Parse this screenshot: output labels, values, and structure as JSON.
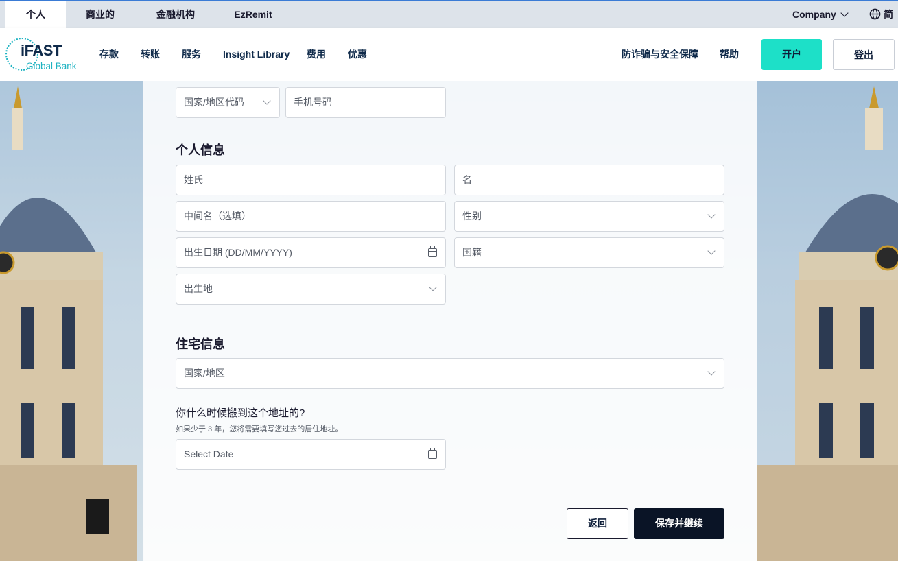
{
  "topbar": {
    "segments": [
      "个人",
      "商业的",
      "金融机构",
      "EzRemit"
    ],
    "company": "Company",
    "language": "简"
  },
  "header": {
    "logo": {
      "line1": "iFAST",
      "line2": "Global Bank"
    },
    "nav": [
      "存款",
      "转账",
      "服务",
      "Insight Library",
      "费用",
      "优惠"
    ],
    "right_links": [
      "防诈骗与安全保障",
      "帮助"
    ],
    "open_account": "开户",
    "login": "登出"
  },
  "form": {
    "phone": {
      "country_code_placeholder": "国家/地区代码",
      "phone_placeholder": "手机号码"
    },
    "personal": {
      "title": "个人信息",
      "surname": "姓氏",
      "given_name": "名",
      "middle_name": "中间名（选填）",
      "gender": "性别",
      "dob": "出生日期 (DD/MM/YYYY)",
      "nationality": "国籍",
      "birthplace": "出生地"
    },
    "residential": {
      "title": "住宅信息",
      "country": "国家/地区",
      "question": "你什么时候搬到这个地址的?",
      "hint": "如果少于 3 年，您将需要填写您过去的居住地址。",
      "date_placeholder": "Select Date"
    },
    "buttons": {
      "back": "返回",
      "save": "保存并继续"
    }
  },
  "colors": {
    "accent": "#1de0c8",
    "brand_dark": "#0a1426",
    "brand_teal": "#1fb3c2"
  }
}
